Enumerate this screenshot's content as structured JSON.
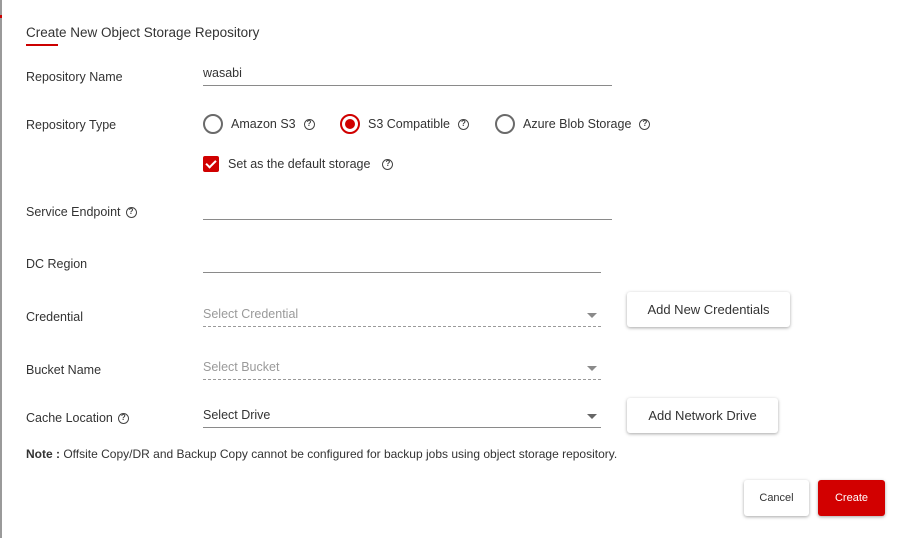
{
  "dialog": {
    "title": "Create New Object Storage Repository"
  },
  "form": {
    "repository_name": {
      "label": "Repository Name",
      "value": "wasabi"
    },
    "repository_type": {
      "label": "Repository Type",
      "options": [
        {
          "label": "Amazon S3",
          "checked": false
        },
        {
          "label": "S3 Compatible",
          "checked": true
        },
        {
          "label": "Azure Blob Storage",
          "checked": false
        }
      ]
    },
    "default_storage": {
      "label": "Set as the default storage",
      "checked": true
    },
    "service_endpoint": {
      "label": "Service Endpoint",
      "value": ""
    },
    "dc_region": {
      "label": "DC Region",
      "value": ""
    },
    "credential": {
      "label": "Credential",
      "placeholder": "Select Credential",
      "add_button": "Add New Credentials"
    },
    "bucket_name": {
      "label": "Bucket Name",
      "placeholder": "Select Bucket"
    },
    "cache_location": {
      "label": "Cache Location",
      "value": "Select Drive",
      "add_button": "Add Network Drive"
    }
  },
  "note": {
    "prefix": "Note :",
    "text": " Offsite Copy/DR and Backup Copy cannot be configured for backup jobs using object storage repository."
  },
  "actions": {
    "cancel": "Cancel",
    "create": "Create"
  },
  "icons": {
    "help": "?"
  },
  "colors": {
    "accent": "#d20000"
  }
}
